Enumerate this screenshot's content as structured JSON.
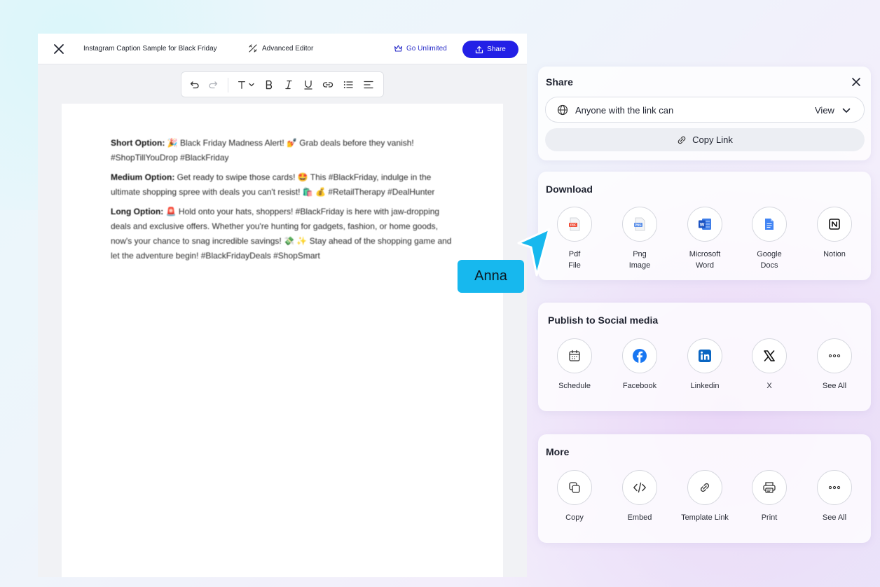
{
  "editor": {
    "title": "Instagram Caption Sample for Black Friday",
    "advanced_editor": "Advanced Editor",
    "go_unlimited": "Go Unlimited",
    "share": "Share"
  },
  "document": {
    "short": {
      "label": "Short Option:",
      "text": " 🎉 Black Friday Madness Alert! 💅 Grab deals before they vanish! #ShopTillYouDrop #BlackFriday"
    },
    "medium": {
      "label": "Medium Option:",
      "text": " Get ready to swipe those cards! 🤩 This #BlackFriday, indulge in the ultimate shopping spree with deals you can't resist! 🛍️ 💰 #RetailTherapy #DealHunter"
    },
    "long": {
      "label": "Long Option:",
      "text": " 🚨 Hold onto your hats, shoppers! #BlackFriday is here with jaw-dropping deals and exclusive offers. Whether you're hunting for gadgets, fashion, or home goods, now's your chance to snag incredible savings! 💸 ✨ Stay ahead of the shopping game and let the adventure begin! #BlackFridayDeals #ShopSmart"
    }
  },
  "share_panel": {
    "title": "Share",
    "link_access": "Anyone with the link can",
    "permission": "View",
    "copy_link": "Copy Link"
  },
  "download": {
    "title": "Download",
    "items": [
      {
        "line1": "Pdf",
        "line2": "File",
        "icon": "pdf-file-icon"
      },
      {
        "line1": "Png",
        "line2": "Image",
        "icon": "png-image-icon"
      },
      {
        "line1": "Microsoft",
        "line2": "Word",
        "icon": "word-icon"
      },
      {
        "line1": "Google",
        "line2": "Docs",
        "icon": "google-docs-icon"
      },
      {
        "line1": "Notion",
        "line2": "",
        "icon": "notion-icon"
      }
    ]
  },
  "social": {
    "title": "Publish to Social media",
    "items": [
      {
        "label": "Schedule",
        "icon": "calendar-icon"
      },
      {
        "label": "Facebook",
        "icon": "facebook-icon"
      },
      {
        "label": "Linkedin",
        "icon": "linkedin-icon"
      },
      {
        "label": "X",
        "icon": "x-icon"
      },
      {
        "label": "See All",
        "icon": "more-icon"
      }
    ]
  },
  "more": {
    "title": "More",
    "items": [
      {
        "label": "Copy",
        "icon": "copy-icon"
      },
      {
        "label": "Embed",
        "icon": "code-icon"
      },
      {
        "label": "Template Link",
        "icon": "link-icon"
      },
      {
        "label": "Print",
        "icon": "printer-icon"
      },
      {
        "label": "See All",
        "icon": "more-icon"
      }
    ]
  },
  "cursor": {
    "name": "Anna",
    "color": "#17b8ee"
  },
  "colors": {
    "accent": "#2320e6",
    "link_accent": "#2d31c9"
  }
}
